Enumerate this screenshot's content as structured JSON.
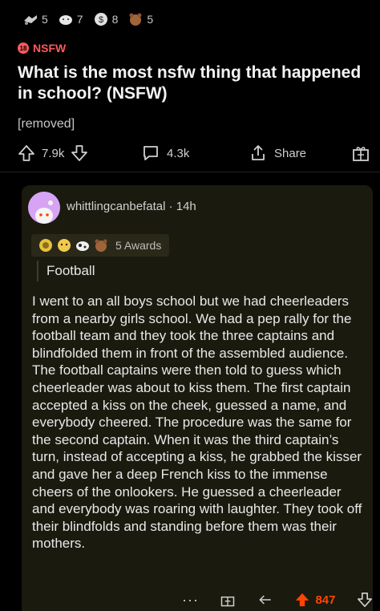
{
  "post": {
    "award_counts": [
      "5",
      "7",
      "8",
      "5"
    ],
    "nsfw_badge_text": "18",
    "nsfw_label": "NSFW",
    "title": "What is the most nsfw thing that happened in school? (NSFW)",
    "body": "[removed]",
    "upvotes": "7.9k",
    "comments": "4.3k",
    "share_label": "Share"
  },
  "comment": {
    "username": "whittlingcanbefatal · 14h",
    "awards_label": "5 Awards",
    "flair": "Football",
    "body": "I went to an all boys school but we had cheerleaders from a nearby girls school. We had a pep rally for the football team and they took the three captains and blindfolded them in front of the assembled audience. The football captains were then told to guess which cheerleader was about to kiss them. The first captain accepted a kiss on the cheek, guessed a name, and everybody cheered. The procedure was the same for the second captain. When it was the third captain’s turn, instead of accepting a kiss, he grabbed the kisser and gave her a deep French kiss to the immense cheers of the onlookers. He guessed a cheerleader and everybody was roaring with laughter. They took off their blindfolds and standing before them was their mothers.",
    "more": "···",
    "score": "847"
  },
  "colors": {
    "accent": "#ff4500",
    "nsfw": "#ff585b",
    "card_bg": "#1b1a0f"
  }
}
